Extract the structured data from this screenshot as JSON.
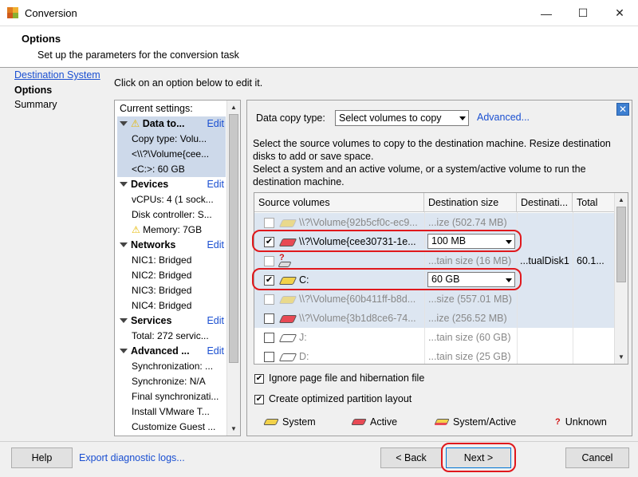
{
  "window": {
    "title": "Conversion",
    "minimize": "—",
    "maximize": "☐",
    "close": "✕"
  },
  "header": {
    "title": "Options",
    "subtitle": "Set up the parameters for the conversion task"
  },
  "nav": {
    "items": [
      {
        "label": "Destination System",
        "link": true
      },
      {
        "label": "Options",
        "current": true
      },
      {
        "label": "Summary"
      }
    ]
  },
  "instruction": "Click on an option below to edit it.",
  "settings": {
    "title": "Current settings:",
    "edit_label": "Edit",
    "sections": [
      {
        "name": "Data to...",
        "warn": true,
        "selected": true,
        "items": [
          "Copy type: Volu...",
          "<\\\\?\\Volume{cee...",
          "<C:>: 60 GB"
        ]
      },
      {
        "name": "Devices",
        "items": [
          "vCPUs: 4 (1 sock...",
          "Disk controller: S...",
          "Memory: 7GB"
        ]
      },
      {
        "name": "Networks",
        "items": [
          "NIC1: Bridged",
          "NIC2: Bridged",
          "NIC3: Bridged",
          "NIC4: Bridged"
        ]
      },
      {
        "name": "Services",
        "items": [
          "Total: 272 servic..."
        ]
      },
      {
        "name": "Advanced ...",
        "items": [
          "Synchronization: ...",
          "Synchronize: N/A",
          "Final synchronizati...",
          "Install VMware T...",
          "Customize Guest ..."
        ]
      }
    ]
  },
  "main": {
    "data_copy_label": "Data copy type:",
    "data_copy_value": "Select volumes to copy",
    "advanced_link": "Advanced...",
    "desc1": "Select the source volumes to copy to the destination machine. Resize destination disks to add or save space.",
    "desc2": "Select a system and an active volume, or a system/active volume to run the destination machine.",
    "columns": [
      "Source volumes",
      "Destination size",
      "Destinati...",
      "Total"
    ],
    "rows": [
      {
        "source": "\\\\?\\Volume{92b5cf0c-ec9...",
        "size": "...ize (502.74 MB)",
        "checked": false,
        "enabled": false,
        "icon": "system"
      },
      {
        "source": "\\\\?\\Volume{cee30731-1e...",
        "size": "100 MB",
        "checked": true,
        "enabled": true,
        "icon": "active",
        "dropdown": true
      },
      {
        "source": "",
        "size": "...tain size (16 MB)",
        "checked": false,
        "enabled": false,
        "icon": "unknown",
        "dest": "...tualDisk1",
        "total": "60.1..."
      },
      {
        "source": "C:",
        "size": "60 GB",
        "checked": true,
        "enabled": true,
        "icon": "system",
        "dropdown": true
      },
      {
        "source": "\\\\?\\Volume{60b411ff-b8d...",
        "size": "...size (557.01 MB)",
        "checked": false,
        "enabled": false,
        "icon": "system"
      },
      {
        "source": "\\\\?\\Volume{3b1d8ce6-74...",
        "size": "...ize (256.52 MB)",
        "checked": false,
        "enabled": true,
        "icon": "active"
      },
      {
        "source": "J:",
        "size": "...tain size (60 GB)",
        "checked": false,
        "enabled": true,
        "icon": "none"
      },
      {
        "source": "D:",
        "size": "...tain size (25 GB)",
        "checked": false,
        "enabled": true,
        "icon": "none"
      }
    ],
    "opt_ignore": "Ignore page file and hibernation file",
    "opt_optimize": "Create optimized partition layout",
    "legend": {
      "system": "System",
      "active": "Active",
      "sysactive": "System/Active",
      "unknown": "Unknown"
    }
  },
  "footer": {
    "help": "Help",
    "export": "Export diagnostic logs...",
    "back": "< Back",
    "next": "Next >",
    "cancel": "Cancel"
  },
  "colors": {
    "system": "#f2d24a",
    "active": "#e84a55",
    "link": "#1a4fd1",
    "highlight": "#e0181c"
  }
}
